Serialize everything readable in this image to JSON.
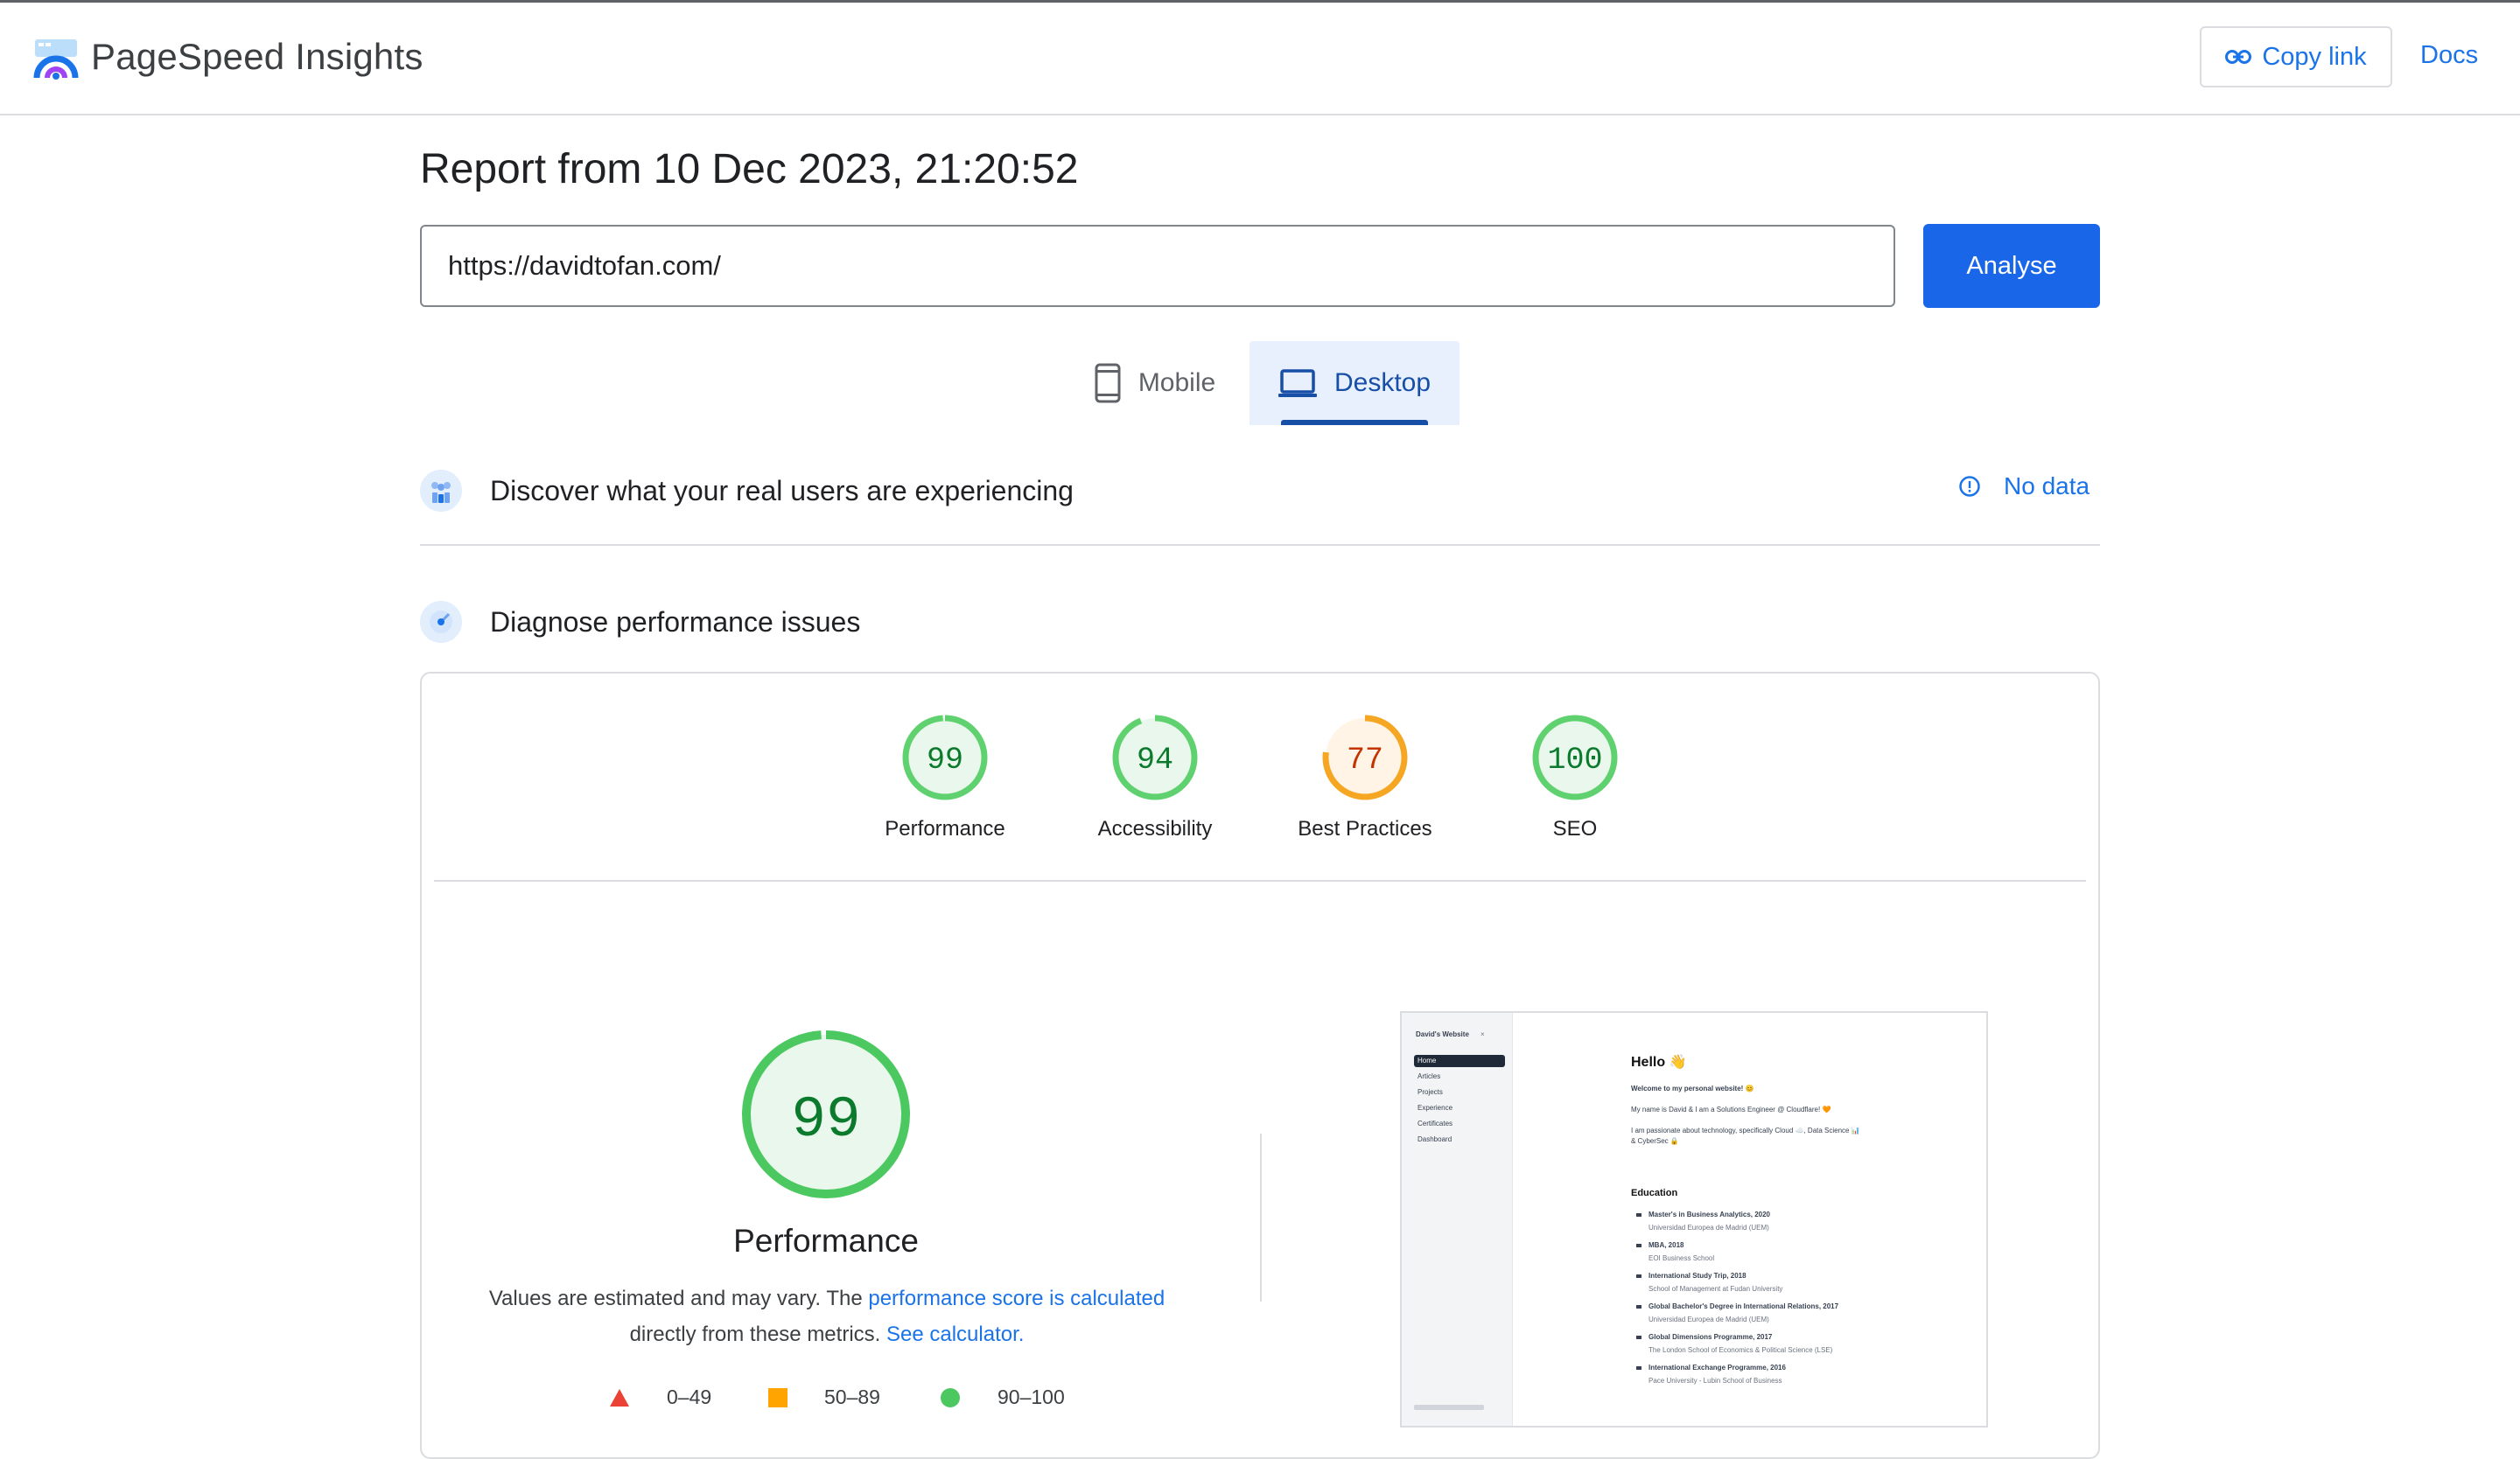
{
  "header": {
    "brand": "PageSpeed Insights",
    "copy_link": "Copy link",
    "docs": "Docs"
  },
  "report": {
    "title": "Report from 10 Dec 2023, 21:20:52",
    "url": "https://davidtofan.com/",
    "analyse": "Analyse"
  },
  "tabs": [
    {
      "label": "Mobile",
      "icon": "phone-icon",
      "selected": false
    },
    {
      "label": "Desktop",
      "icon": "laptop-icon",
      "selected": true
    }
  ],
  "field_section": {
    "title": "Discover what your real users are experiencing",
    "status": "No data"
  },
  "lab_section": {
    "title": "Diagnose performance issues"
  },
  "scores": [
    {
      "label": "Performance",
      "value": 99,
      "color": "#0c7a2c",
      "ring": "#5fd16f"
    },
    {
      "label": "Accessibility",
      "value": 94,
      "color": "#0c7a2c",
      "ring": "#5fd16f"
    },
    {
      "label": "Best Practices",
      "value": 77,
      "color": "#c33300",
      "ring": "#f5a623"
    },
    {
      "label": "SEO",
      "value": 100,
      "color": "#0c7a2c",
      "ring": "#5fd16f"
    }
  ],
  "main_score": {
    "label": "Performance",
    "value": 99
  },
  "note": {
    "text1": "Values are estimated and may vary. The ",
    "link1": "performance score is calculated",
    "text2": "directly from these metrics. ",
    "link2": "See calculator."
  },
  "legend": [
    {
      "range": "0–49",
      "shape": "triangle",
      "color": "#ea4335"
    },
    {
      "range": "50–89",
      "shape": "square",
      "color": "#ffa400"
    },
    {
      "range": "90–100",
      "shape": "circle",
      "color": "#4cc861"
    }
  ],
  "thumbnail": {
    "site_title": "David's Website",
    "nav": [
      "Home",
      "Articles",
      "Projects",
      "Experience",
      "Certificates",
      "Dashboard"
    ],
    "hello": "Hello 👋",
    "welcome": "Welcome to my personal website! 😊",
    "intro": "My name is David & I am a Solutions Engineer @ Cloudflare! 🧡",
    "passion": "I am passionate about technology, specifically Cloud ☁️, Data Science 📊",
    "passion2": "& CyberSec 🔒",
    "education_heading": "Education",
    "education": [
      {
        "degree": "Master's in Business Analytics, 2020",
        "school": "Universidad Europea de Madrid (UEM)"
      },
      {
        "degree": "MBA, 2018",
        "school": "EOI Business School"
      },
      {
        "degree": "International Study Trip, 2018",
        "school": "School of Management at Fudan University"
      },
      {
        "degree": "Global Bachelor's Degree in International Relations, 2017",
        "school": "Universidad Europea de Madrid (UEM)"
      },
      {
        "degree": "Global Dimensions Programme, 2017",
        "school": "The London School of Economics & Political Science (LSE)"
      },
      {
        "degree": "International Exchange Programme, 2016",
        "school": "Pace University - Lubin School of Business"
      }
    ]
  }
}
